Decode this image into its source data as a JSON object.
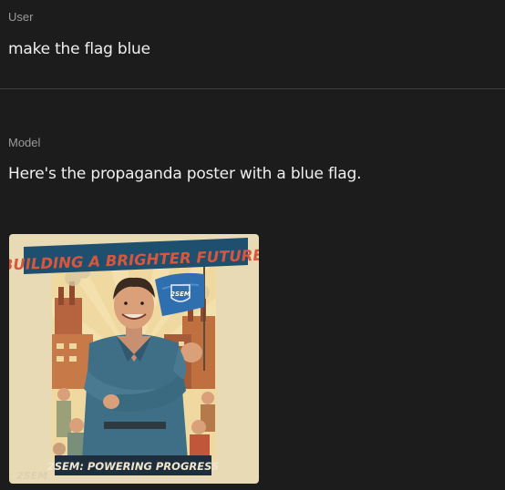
{
  "user_turn": {
    "role": "User",
    "message": "make the flag blue"
  },
  "model_turn": {
    "role": "Model",
    "message": "Here's the propaganda poster with a blue flag."
  },
  "poster": {
    "headline": "BUILDING A BRIGHTER FUTURE!",
    "flag_text": "2SEM",
    "footer": "2SEM: POWERING PROGRESS",
    "watermark": "2SEM",
    "colors": {
      "headline_banner": "#1f4f6e",
      "headline_text": "#d8573c",
      "flag": "#2f6fb0",
      "paper": "#e9dcb9",
      "shirt": "#3f6f86",
      "footer_banner": "#1e2e3c"
    }
  }
}
